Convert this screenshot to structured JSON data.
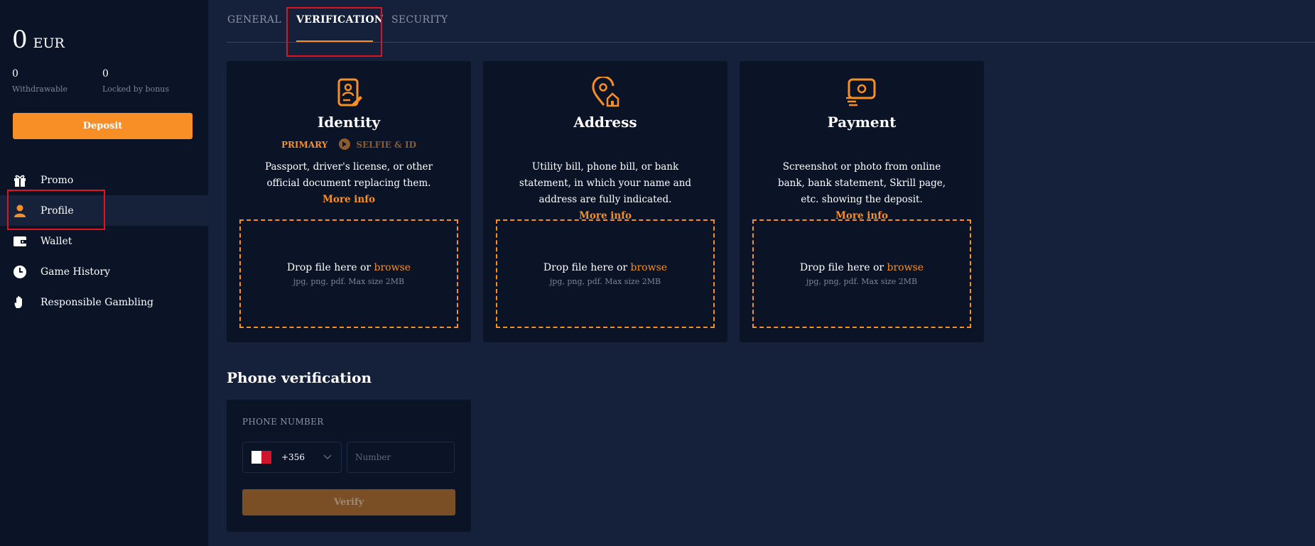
{
  "sidebar": {
    "balance_amount": "0",
    "balance_currency": "EUR",
    "withdrawable_value": "0",
    "withdrawable_label": "Withdrawable",
    "locked_value": "0",
    "locked_label": "Locked by bonus",
    "deposit_label": "Deposit",
    "items": [
      {
        "label": "Promo",
        "icon": "gift-icon"
      },
      {
        "label": "Profile",
        "icon": "user-icon"
      },
      {
        "label": "Wallet",
        "icon": "wallet-icon"
      },
      {
        "label": "Game History",
        "icon": "clock-icon"
      },
      {
        "label": "Responsible Gambling",
        "icon": "hand-icon"
      }
    ]
  },
  "tabs": [
    {
      "label": "GENERAL"
    },
    {
      "label": "VERIFICATION"
    },
    {
      "label": "SECURITY"
    }
  ],
  "cards": [
    {
      "title": "Identity",
      "sub_primary": "PRIMARY",
      "sub_secondary": "SELFIE & ID",
      "desc": "Passport, driver's license, or other official document replacing them.",
      "more": "More info",
      "drop_text": "Drop file here or ",
      "browse": "browse",
      "hint": "jpg, png, pdf. Max size 2MB"
    },
    {
      "title": "Address",
      "desc": "Utility bill, phone bill, or bank statement, in which your name and address are fully indicated.",
      "more": "More info",
      "drop_text": "Drop file here or ",
      "browse": "browse",
      "hint": "jpg, png, pdf. Max size 2MB"
    },
    {
      "title": "Payment",
      "desc": "Screenshot or photo from online bank, bank statement, Skrill page, etc. showing the deposit.",
      "more": "More info",
      "drop_text": "Drop file here or ",
      "browse": "browse",
      "hint": "jpg, png, pdf. Max size 2MB"
    }
  ],
  "phone": {
    "title": "Phone verification",
    "label": "PHONE NUMBER",
    "country_code": "+356",
    "number_placeholder": "Number",
    "verify_label": "Verify"
  },
  "colors": {
    "accent": "#f78f26",
    "sidebar_bg": "#0b1427",
    "main_bg": "#15213a",
    "highlight": "#e0141e"
  }
}
